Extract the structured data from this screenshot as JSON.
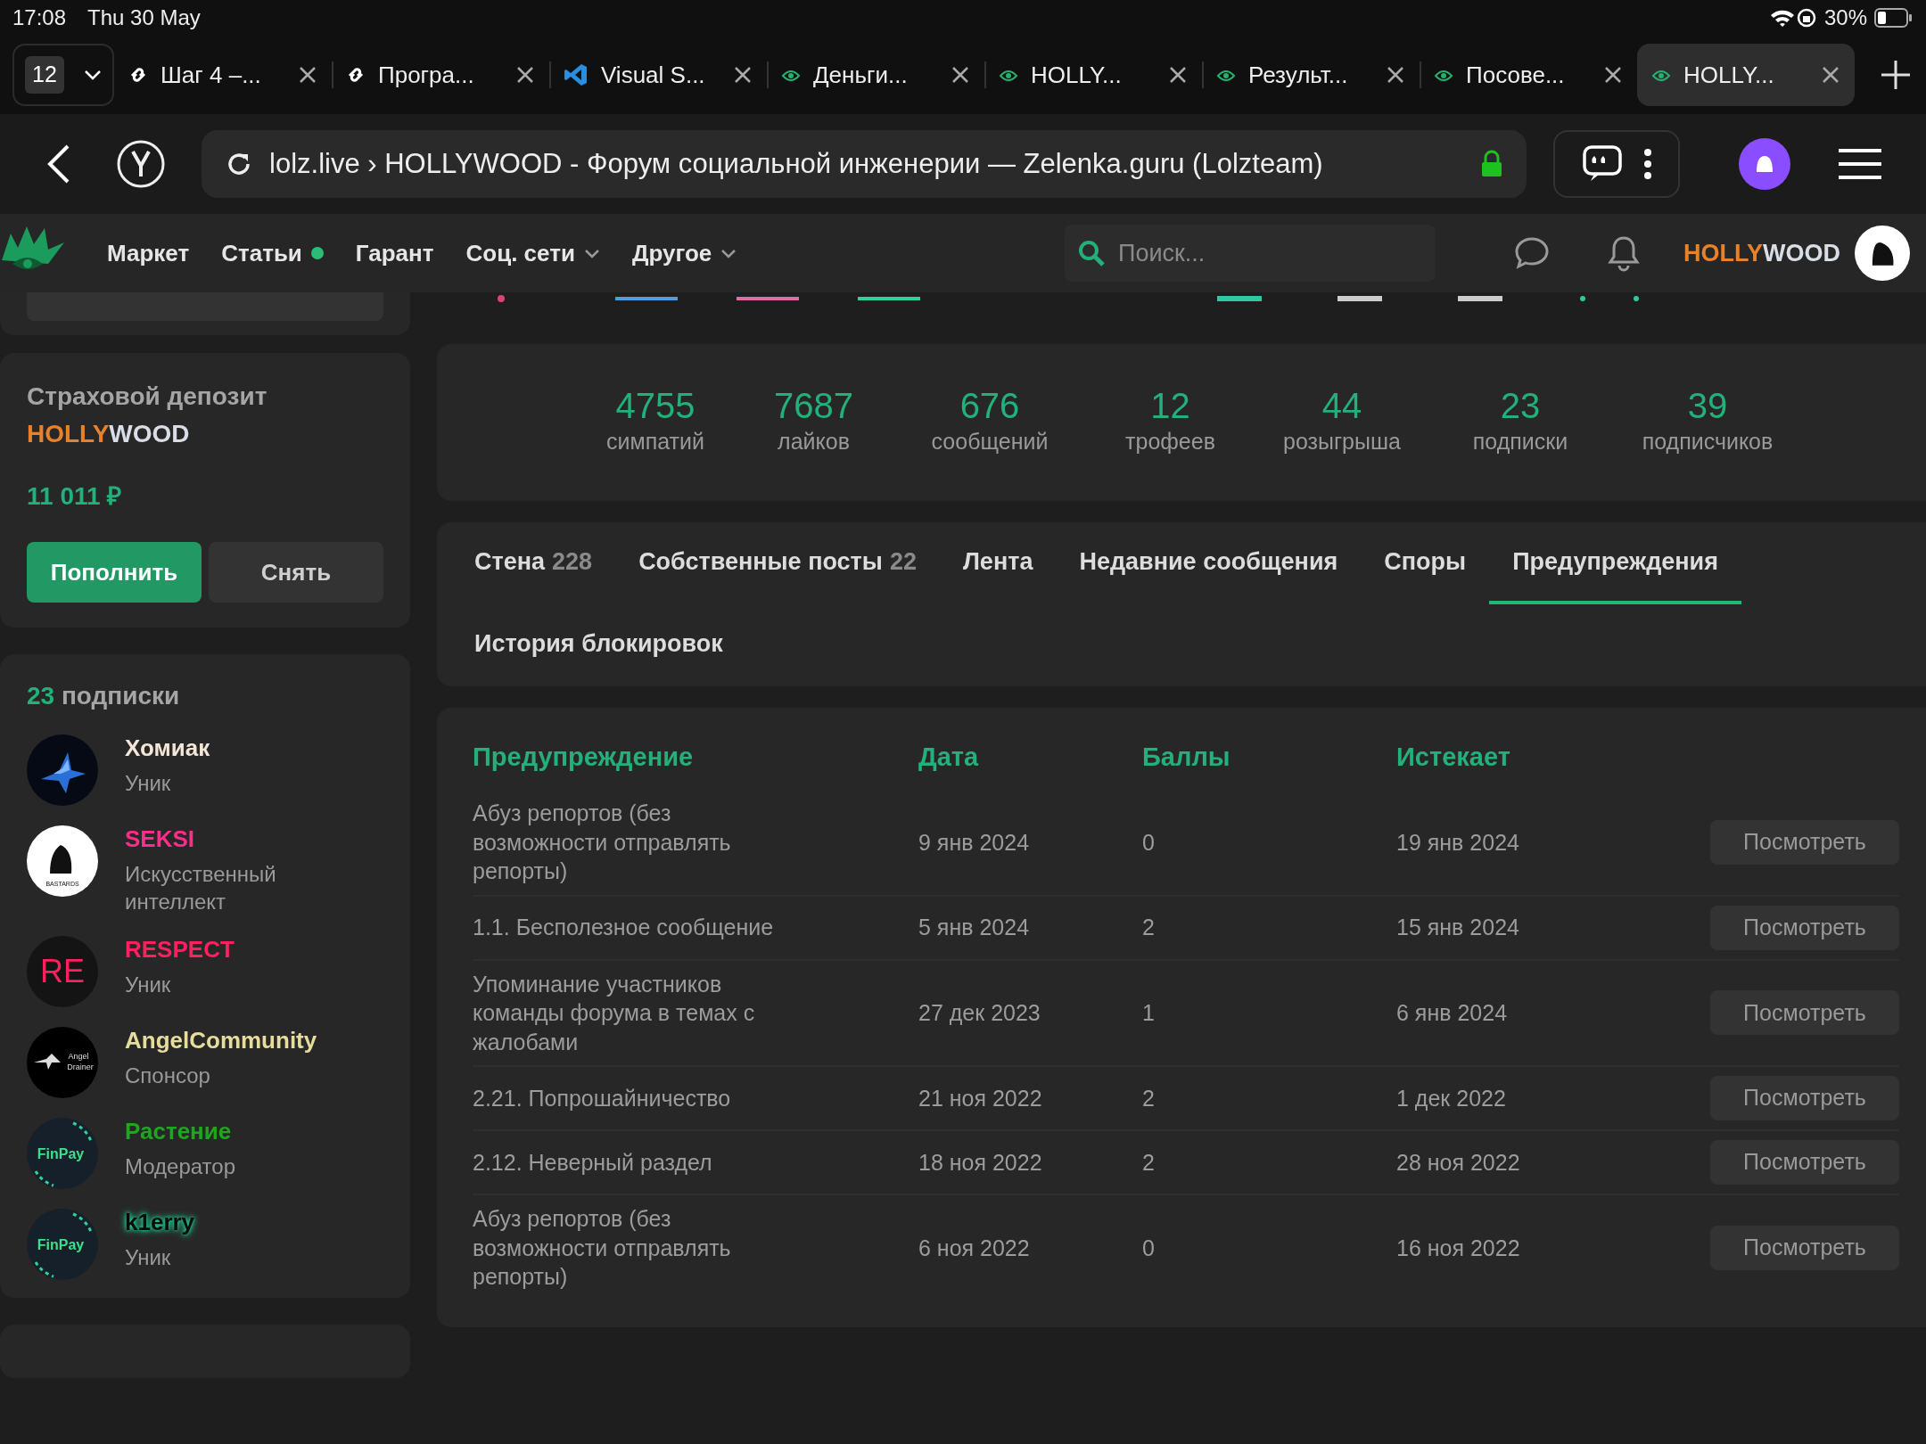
{
  "status_bar": {
    "time": "17:08",
    "date": "Thu 30 May",
    "battery": "30%"
  },
  "browser": {
    "tab_count": "12",
    "tabs": [
      {
        "title": "Шаг 4 –...",
        "kind": "link",
        "selected": false
      },
      {
        "title": "Програ...",
        "kind": "link",
        "selected": false
      },
      {
        "title": "Visual S...",
        "kind": "editor",
        "selected": false
      },
      {
        "title": "Деньги...",
        "kind": "site",
        "selected": false
      },
      {
        "title": "HOLLY...",
        "kind": "site",
        "selected": false
      },
      {
        "title": "Результ...",
        "kind": "site",
        "selected": false
      },
      {
        "title": "Посове...",
        "kind": "site",
        "selected": false
      },
      {
        "title": "HOLLY...",
        "kind": "site",
        "selected": true
      }
    ],
    "address": "lolz.live › HOLLYWOOD - Форум социальной инженерии — Zelenka.guru (Lolzteam)"
  },
  "site_nav": {
    "items": [
      {
        "label": "Маркет",
        "dot": false,
        "dropdown": false
      },
      {
        "label": "Статьи",
        "dot": true,
        "dropdown": false
      },
      {
        "label": "Гарант",
        "dot": false,
        "dropdown": false
      },
      {
        "label": "Соц. сети",
        "dot": false,
        "dropdown": true
      },
      {
        "label": "Другое",
        "dot": false,
        "dropdown": true
      }
    ],
    "search": {
      "placeholder": "Поиск..."
    },
    "username_parts": [
      {
        "text": "HOLLY",
        "color": "#e8822a"
      },
      {
        "text": "WOOD",
        "color": "#d9dde6"
      }
    ]
  },
  "deposit": {
    "title": "Страховой депозит",
    "owner_parts": [
      {
        "text": "HOLLY",
        "color": "#e8822a"
      },
      {
        "text": "WOOD",
        "color": "#d9dde6"
      }
    ],
    "amount": "11 011 ₽",
    "buttons": [
      {
        "label": "Пополнить",
        "kind": "primary"
      },
      {
        "label": "Снять",
        "kind": "secondary"
      }
    ]
  },
  "subscriptions": {
    "count": "23",
    "title": "подписки",
    "users": [
      {
        "name": "Хомиак",
        "role": "Уник",
        "color": "#f3e6d8",
        "glow": false,
        "avatar": {
          "kind": "spark"
        }
      },
      {
        "name": "SEKSI",
        "role": "Искусственный интеллект",
        "color": "#ff2d8a",
        "glow": false,
        "avatar": {
          "kind": "bastards",
          "text": "BASTARDS"
        }
      },
      {
        "name": "RESPECT",
        "role": "Уник",
        "color": "#ff2060",
        "glow": false,
        "avatar": {
          "kind": "letters",
          "text": "RE"
        }
      },
      {
        "name": "AngelCommunity",
        "role": "Спонсор",
        "color": "#e6dc9c",
        "glow": false,
        "avatar": {
          "kind": "angel",
          "text": "Angel Drainer"
        }
      },
      {
        "name": "Растение",
        "role": "Модератор",
        "color": "#1fa51f",
        "glow": false,
        "avatar": {
          "kind": "finpay",
          "text": "FinPay"
        }
      },
      {
        "name": "k1erry",
        "role": "Уник",
        "color": "#0a0a0a",
        "glow": true,
        "avatar": {
          "kind": "finpay",
          "text": "FinPay"
        }
      }
    ]
  },
  "stats": [
    {
      "value": "4755",
      "label": "симпатий"
    },
    {
      "value": "7687",
      "label": "лайков"
    },
    {
      "value": "676",
      "label": "сообщений"
    },
    {
      "value": "12",
      "label": "трофеев"
    },
    {
      "value": "44",
      "label": "розыгрыша"
    },
    {
      "value": "23",
      "label": "подписки"
    },
    {
      "value": "39",
      "label": "подписчиков"
    }
  ],
  "profile_tabs": [
    {
      "label": "Стена",
      "count": "228",
      "selected": false
    },
    {
      "label": "Собственные посты",
      "count": "22",
      "selected": false
    },
    {
      "label": "Лента",
      "selected": false
    },
    {
      "label": "Недавние сообщения",
      "selected": false
    },
    {
      "label": "Споры",
      "selected": false
    },
    {
      "label": "Предупреждения",
      "selected": true
    },
    {
      "label": "История блокировок",
      "selected": false
    }
  ],
  "warnings": {
    "columns": [
      "Предупреждение",
      "Дата",
      "Баллы",
      "Истекает"
    ],
    "rows": [
      {
        "warning": "Абуз репортов (без возможности отправлять репорты)",
        "date": "9 янв 2024",
        "points": "0",
        "expires": "19 янв 2024",
        "action": "Посмотреть"
      },
      {
        "warning": "1.1. Бесполезное сообщение",
        "date": "5 янв 2024",
        "points": "2",
        "expires": "15 янв 2024",
        "action": "Посмотреть"
      },
      {
        "warning": "Упоминание участников команды форума в темах с жалобами",
        "date": "27 дек 2023",
        "points": "1",
        "expires": "6 янв 2024",
        "action": "Посмотреть"
      },
      {
        "warning": "2.21. Попрошайничество",
        "date": "21 ноя 2022",
        "points": "2",
        "expires": "1 дек 2022",
        "action": "Посмотреть"
      },
      {
        "warning": "2.12. Неверный раздел",
        "date": "18 ноя 2022",
        "points": "2",
        "expires": "28 ноя 2022",
        "action": "Посмотреть"
      },
      {
        "warning": "Абуз репортов (без возможности отправлять репорты)",
        "date": "6 ноя 2022",
        "points": "0",
        "expires": "16 ноя 2022",
        "action": "Посмотреть"
      }
    ]
  }
}
